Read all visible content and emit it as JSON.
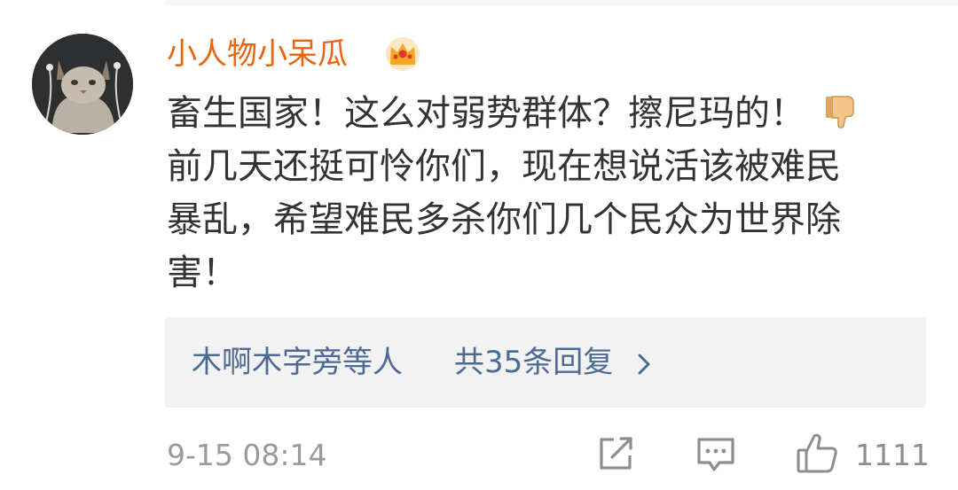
{
  "comment": {
    "username": "小人物小呆瓜",
    "user_badge_icon": "crown-vip-icon",
    "lines": [
      "畜生国家！这么对弱势群体？擦尼玛的！",
      "前几天还挺可怜你们，现在想说活该被难民",
      "暴乱，希望难民多杀你们几个民众为世界除",
      "害！"
    ],
    "inline_emoji": "thumbs-down-emoji",
    "timestamp": "9-15 08:14",
    "like_count": "1111"
  },
  "replies": {
    "names": "木啊木字旁等人",
    "count_text": "共35条回复",
    "chevron": "chevron-right-icon"
  },
  "colors": {
    "username": "#e8650f",
    "body_text": "#333333",
    "reply_link": "#4c6a94",
    "reply_bg": "#f2f2f2",
    "meta_text": "#9a9a9a"
  }
}
